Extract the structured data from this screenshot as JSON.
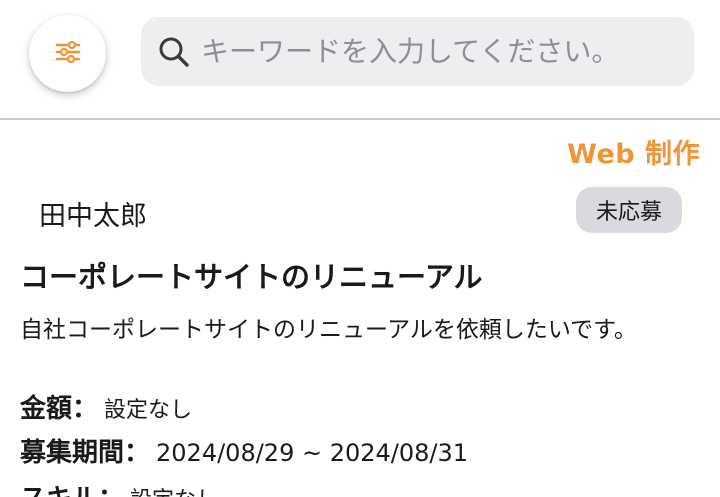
{
  "header": {
    "search": {
      "placeholder": "キーワードを入力してください。",
      "value": ""
    },
    "icons": {
      "filter": "sliders-icon",
      "search": "magnifier-icon"
    }
  },
  "job": {
    "category": "Web 制作",
    "author": "田中太郎",
    "status": "未応募",
    "title": "コーポレートサイトのリニューアル",
    "description": "自社コーポレートサイトのリニューアルを依頼したいです。",
    "details": {
      "amount_label": "金額：",
      "amount_value": "設定なし",
      "period_label": "募集期間：",
      "period_value": "2024/08/29 ~ 2024/08/31",
      "skill_label": "スキル：",
      "skill_value": "設定なし"
    }
  },
  "colors": {
    "accent": "#ef9538",
    "badge_bg": "#d9d9de",
    "search_bg": "#eeeef0",
    "divider": "#c9c9cc"
  }
}
